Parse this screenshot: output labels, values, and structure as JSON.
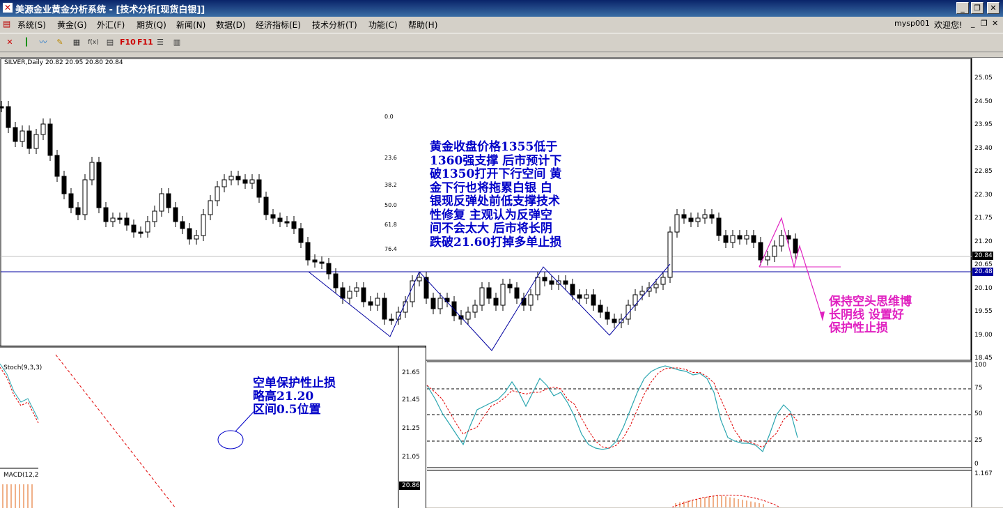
{
  "window": {
    "title": "美源金业黄金分析系统 - [技术分析[现货白银]]",
    "user": "mysp001",
    "welcome": "欢迎您!"
  },
  "menu": [
    "系统(S)",
    "黄金(G)",
    "外汇(F)",
    "期货(Q)",
    "新闻(N)",
    "数据(D)",
    "经济指标(E)",
    "技术分析(T)",
    "功能(C)",
    "帮助(H)"
  ],
  "toolbar": {
    "icons": [
      "close-chart-icon",
      "candles-icon",
      "line-chart-icon",
      "pencil-icon",
      "grid-icon",
      "fx-icon",
      "template-icon",
      "f10-icon",
      "f11-icon",
      "list-icon",
      "report-icon"
    ],
    "f10": "F10",
    "f11": "F11",
    "fx": "f(x)"
  },
  "chart": {
    "header": "SILVER,Daily  20.82 20.95 20.80 20.84",
    "price_labels": [
      "25.05",
      "24.50",
      "23.95",
      "23.40",
      "22.85",
      "22.30",
      "21.75",
      "21.20",
      "20.65",
      "20.10",
      "19.55",
      "19.00",
      "18.45"
    ],
    "current_price": "20.84",
    "line_price": "20.48",
    "annotation_main": [
      "黄金收盘价格1355低于",
      "1360强支撑 后市预计下",
      "破1350打开下行空间 黄",
      "金下行也将拖累白银 白",
      "银现反弹处前低支撑技术",
      "性修复 主观认为反弹空",
      "间不会太大 后市将长阴",
      "跌破21.60打掉多单止损"
    ],
    "annotation_right": [
      "保持空头思维博",
      "长阴线 设置好",
      "保护性止损"
    ]
  },
  "stoch": {
    "label": "Stoch(9,3,3)",
    "levels": [
      "100",
      "75",
      "50",
      "25",
      "0"
    ]
  },
  "macd": {
    "label": "MACD(12,2",
    "value": "1.167"
  },
  "inset": {
    "fib_levels": [
      "0.0",
      "23.6",
      "38.2",
      "50.0",
      "61.8",
      "76.4"
    ],
    "price_labels": [
      "21.65",
      "21.45",
      "21.25",
      "21.05"
    ],
    "current_price": "20.86",
    "annotation": [
      "空单保护性止损",
      "略高21.20",
      "区间0.5位置"
    ]
  }
}
